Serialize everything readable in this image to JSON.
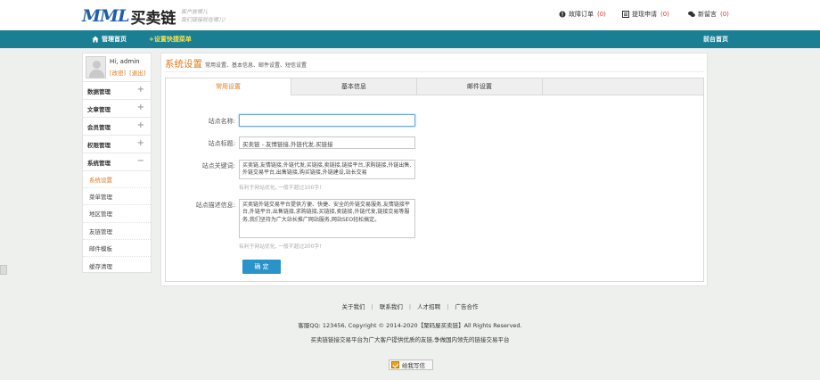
{
  "header": {
    "logo_mark": "MML",
    "logo_text": "买卖链",
    "slogan_line1": "客户放哪儿",
    "slogan_line2": "我们链接就在哪儿!",
    "links": [
      {
        "label": "故障订单",
        "count": "(0)"
      },
      {
        "label": "提现申请",
        "count": "(0)"
      },
      {
        "label": "新留言",
        "count": "(0)"
      }
    ]
  },
  "nav": {
    "home": "管理首页",
    "quick_menu": "+设置快捷菜单",
    "front_page": "前台首页"
  },
  "sidebar": {
    "greeting": "Hi, admin",
    "profile_link": "[改密]",
    "logout_link": "[退出]",
    "menus": [
      {
        "label": "数据管理",
        "toggle": "+"
      },
      {
        "label": "文章管理",
        "toggle": "+"
      },
      {
        "label": "会员管理",
        "toggle": "+"
      },
      {
        "label": "权限管理",
        "toggle": "+"
      },
      {
        "label": "系统管理",
        "toggle": "−"
      }
    ],
    "sub_items": [
      {
        "label": "系统设置"
      },
      {
        "label": "菜单管理"
      },
      {
        "label": "地区管理"
      },
      {
        "label": "友链管理"
      },
      {
        "label": "邮件模板"
      },
      {
        "label": "缓存清理"
      }
    ]
  },
  "main": {
    "title": "系统设置",
    "description": "常用设置、基本信息、邮件设置、短信设置",
    "tabs": [
      "常用设置",
      "基本信息",
      "邮件设置"
    ],
    "form": {
      "site_name_label": "站点名称:",
      "site_name_value": "",
      "site_title_label": "站点标题:",
      "site_title_value": "买卖链 - 友情链接,外链代发,买链接",
      "keywords_label": "站点关键词:",
      "keywords_value": "买卖链,友情链接,外链代发,买链接,卖链接,链接平台,求购链接,外链出售,外链交易平台,出售链接,购买链接,外链建设,站长交易",
      "keywords_hint": "有利于网站优化, 一般不超过100字!",
      "description_label": "站点描述信息:",
      "description_value": "买卖链外链交易平台提供方便、快捷、安全的外链交易服务,友情链接平台,外链平台,出售链接,求购链接,买链接,卖链接,外链代发,链接交易等服务,我们坚持为广大站长推广网站服务,网站SEO轻松搞定。",
      "description_hint": "有利于网站优化, 一般不超过200字!",
      "submit_label": "确 定"
    }
  },
  "footer": {
    "links": [
      "关于我们",
      "联系我们",
      "人才招聘",
      "广告合作"
    ],
    "separator": "|",
    "copyright": "客服QQ: 123456, Copyright © 2014-2020【聚码屋买卖链】All Rights Reserved.",
    "description": "买卖链链接交易平台为广大客户提供优质的友链,争做国内领先的链接交易平台",
    "write_to_us": "给我写信"
  }
}
